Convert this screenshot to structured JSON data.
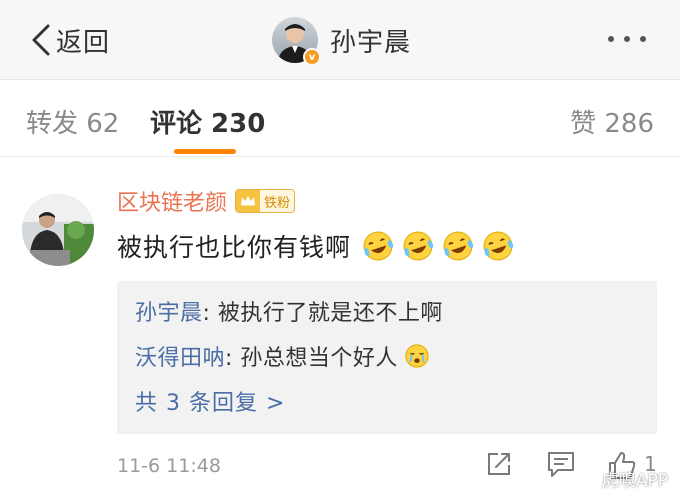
{
  "nav": {
    "back_label": "返回",
    "user_name": "孙宇晨",
    "verified_badge": "v",
    "icons": [
      "back-chevron-icon",
      "more-dots-icon"
    ]
  },
  "tabs": [
    {
      "label": "转发 62",
      "active": false
    },
    {
      "label": "评论 230",
      "active": true
    },
    {
      "label": "赞 286",
      "active": false
    }
  ],
  "colors": {
    "accent": "#ff8200",
    "commenter_name": "#eb7350",
    "reply_name": "#4a6ea5",
    "reply_bg": "#f2f2f2"
  },
  "comment": {
    "author": "区块链老颜",
    "fan_badge": "铁粉",
    "text": "被执行也比你有钱啊",
    "emoji": [
      "laugh-cry-emoji",
      "laugh-cry-emoji",
      "laugh-cry-emoji",
      "laugh-cry-emoji"
    ],
    "replies": [
      {
        "author": "孙宇晨",
        "text": ": 被执行了就是还不上啊"
      },
      {
        "author": "沃得田呐",
        "text": ": 孙总想当个好人",
        "emoji": "tearful-emoji"
      }
    ],
    "more_replies": "共 3 条回复 >",
    "time": "11-6 11:48",
    "like_count": "1",
    "actions": [
      "share-icon",
      "comment-icon",
      "like-icon"
    ]
  },
  "watermark": "虎嗅APP"
}
